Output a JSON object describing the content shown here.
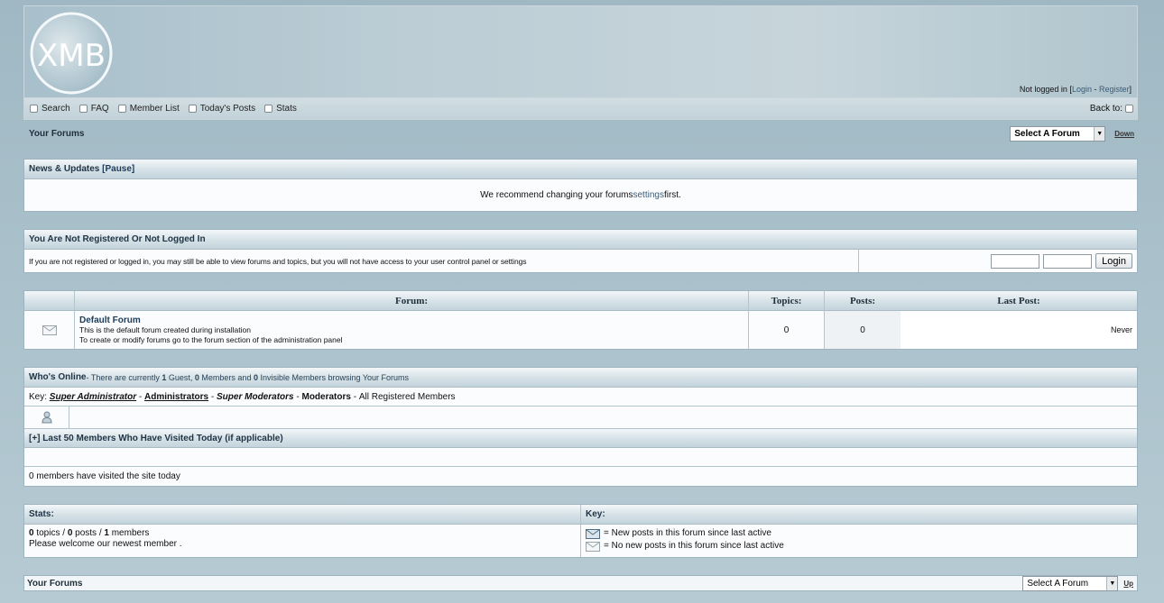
{
  "header": {
    "logo_text": "XMB",
    "login_status": {
      "prefix": "Not logged in [",
      "login": "Login",
      "sep": " - ",
      "register": "Register",
      "suffix": "]"
    }
  },
  "nav": {
    "items": [
      "Search",
      "FAQ",
      "Member List",
      "Today's Posts",
      "Stats"
    ],
    "back_to": "Back to:"
  },
  "forum_bar_top": {
    "label": "Your Forums",
    "select": "Select A Forum",
    "jump": "Down"
  },
  "news": {
    "title": "News & Updates",
    "pause": "[Pause]",
    "text_before": "We recommend changing your forums ",
    "link": "settings",
    "text_after": " first."
  },
  "not_registered": {
    "title": "You Are Not Registered Or Not Logged In",
    "text": "If you are not registered or logged in, you may still be able to view forums and topics, but you will not have access to your user control panel or settings",
    "login_button": "Login"
  },
  "forums_table": {
    "headers": [
      "Forum:",
      "Topics:",
      "Posts:",
      "Last Post:"
    ],
    "rows": [
      {
        "name": "Default Forum",
        "desc1": "This is the default forum created during installation",
        "desc2": "To create or modify forums go to the forum section of the administration panel",
        "topics": "0",
        "posts": "0",
        "last_post": "Never"
      }
    ]
  },
  "whos_online": {
    "title": "Who's Online",
    "summary": {
      "p1": " - There are currently ",
      "guests": "1",
      "p2": " Guest, ",
      "members": "0",
      "p3": " Members and ",
      "invisible": "0",
      "p4": " Invisible Members browsing Your Forums"
    },
    "key_label": "Key: ",
    "key_items": [
      "Super Administrator",
      "Administrators",
      "Super Moderators",
      "Moderators",
      "All Registered Members"
    ],
    "last50_title": "[+] Last 50 Members Who Have Visited Today (if applicable)",
    "visited_text": "0 members have visited the site today"
  },
  "stats": {
    "title": "Stats:",
    "topics": "0",
    "topics_label": " topics / ",
    "posts": "0",
    "posts_label": " posts / ",
    "members": "1",
    "members_label": " members",
    "welcome": "Please welcome our newest member ."
  },
  "key": {
    "title": "Key:",
    "new_posts": "= New posts in this forum since last active",
    "no_new_posts": "= No new posts in this forum since last active"
  },
  "forum_bar_bottom": {
    "label": "Your Forums",
    "select": "Select A Forum",
    "jump": "Up"
  }
}
